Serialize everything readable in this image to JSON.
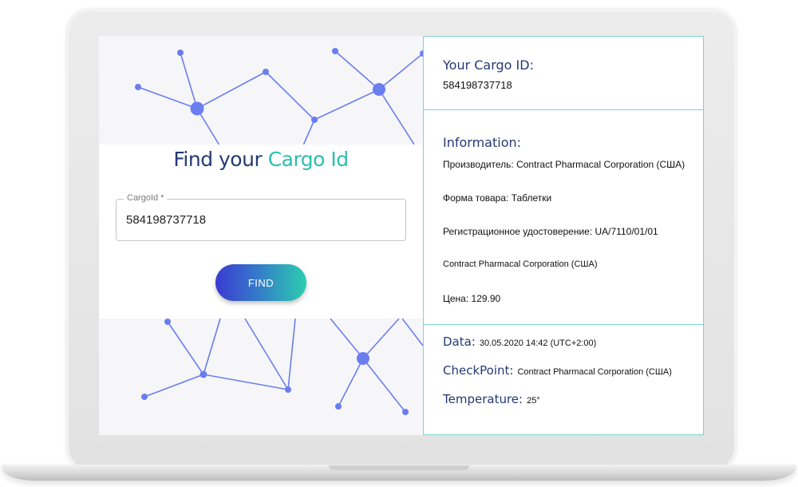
{
  "form": {
    "title_part1": "Find your",
    "title_part2": "Cargo Id",
    "field_label": "CargoId *",
    "field_value": "584198737718",
    "find_label": "FIND"
  },
  "cargo": {
    "id_heading": "Your Cargo ID:",
    "id_value": "584198737718"
  },
  "information": {
    "heading": "Information:",
    "rows": [
      "Производитель: Contract Pharmacal Corporation (США)",
      "Форма товара: Таблетки",
      "Регистрационное удостоверение: UA/7110/01/01",
      "Contract Pharmacal Corporation (США)",
      "Цена: 129.90"
    ]
  },
  "tracking": {
    "data_label": "Data:",
    "data_value": "30.05.2020 14:42 (UTC+2:00)",
    "checkpoint_label": "CheckPoint:",
    "checkpoint_value": "Contract Pharmacal Corporation (США)",
    "temperature_label": "Temperature:",
    "temperature_value": "25°"
  },
  "colors": {
    "heading": "#243a73",
    "accent": "#2bbfb0",
    "divider": "#7dd3d3",
    "node": "#6a7ef0"
  }
}
